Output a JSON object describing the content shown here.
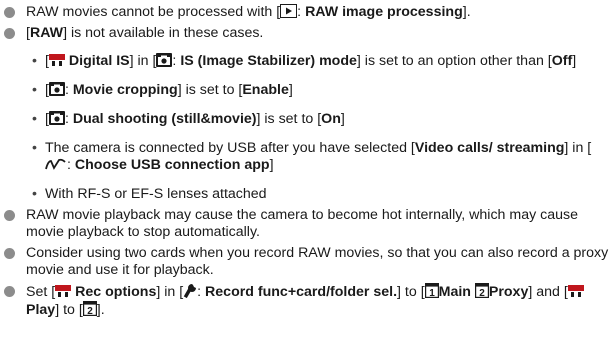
{
  "items": [
    {
      "type": "bullet",
      "parts": [
        {
          "t": "RAW movies cannot be processed with ["
        },
        {
          "icon": "playback-icon"
        },
        {
          "t": ": "
        },
        {
          "b": "RAW image processing"
        },
        {
          "t": "]."
        }
      ]
    },
    {
      "type": "bullet",
      "parts": [
        {
          "t": "["
        },
        {
          "b": "RAW"
        },
        {
          "t": "] is not available in these cases."
        }
      ]
    },
    {
      "type": "sub",
      "parts": [
        {
          "t": "["
        },
        {
          "icon": "movie-camera-icon"
        },
        {
          "t": " "
        },
        {
          "b": "Digital IS"
        },
        {
          "t": "] in ["
        },
        {
          "icon": "camera-icon"
        },
        {
          "t": ": "
        },
        {
          "b": "IS (Image Stabilizer) mode"
        },
        {
          "t": "] is set to an option other than ["
        },
        {
          "b": "Off"
        },
        {
          "t": "]"
        }
      ]
    },
    {
      "type": "sub",
      "parts": [
        {
          "t": "["
        },
        {
          "icon": "camera-icon"
        },
        {
          "t": ": "
        },
        {
          "b": "Movie cropping"
        },
        {
          "t": "] is set to ["
        },
        {
          "b": "Enable"
        },
        {
          "t": "]"
        }
      ]
    },
    {
      "type": "sub",
      "parts": [
        {
          "t": "["
        },
        {
          "icon": "camera-icon"
        },
        {
          "t": ": "
        },
        {
          "b": "Dual shooting (still&movie)"
        },
        {
          "t": "] is set to ["
        },
        {
          "b": "On"
        },
        {
          "t": "]"
        }
      ]
    },
    {
      "type": "sub",
      "parts": [
        {
          "t": "The camera is connected by USB after you have selected ["
        },
        {
          "b": "Video calls/ streaming"
        },
        {
          "t": "] in ["
        },
        {
          "icon": "wireless-icon"
        },
        {
          "t": ": "
        },
        {
          "b": "Choose USB connection app"
        },
        {
          "t": "]"
        }
      ]
    },
    {
      "type": "sub",
      "parts": [
        {
          "t": "With RF-S or EF-S lenses attached"
        }
      ]
    },
    {
      "type": "bullet",
      "parts": [
        {
          "t": "RAW movie playback may cause the camera to become hot internally, which may cause movie playback to stop automatically."
        }
      ]
    },
    {
      "type": "bullet",
      "parts": [
        {
          "t": "Consider using two cards when you record RAW movies, so that you can also record a proxy movie and use it for playback."
        }
      ]
    },
    {
      "type": "bullet",
      "parts": [
        {
          "t": "Set ["
        },
        {
          "icon": "movie-camera-icon"
        },
        {
          "t": " "
        },
        {
          "b": "Rec options"
        },
        {
          "t": "] in ["
        },
        {
          "icon": "setup-icon"
        },
        {
          "t": ": "
        },
        {
          "b": "Record func+card/folder sel."
        },
        {
          "t": "] to ["
        },
        {
          "icon": "card-1-icon"
        },
        {
          "b": "Main "
        },
        {
          "icon": "card-2-icon"
        },
        {
          "b": "Proxy"
        },
        {
          "t": "] and ["
        },
        {
          "icon": "movie-camera-icon"
        },
        {
          "t": " "
        },
        {
          "b": "Play"
        },
        {
          "t": "] to ["
        },
        {
          "icon": "card-2-icon"
        },
        {
          "t": "]."
        }
      ]
    }
  ]
}
